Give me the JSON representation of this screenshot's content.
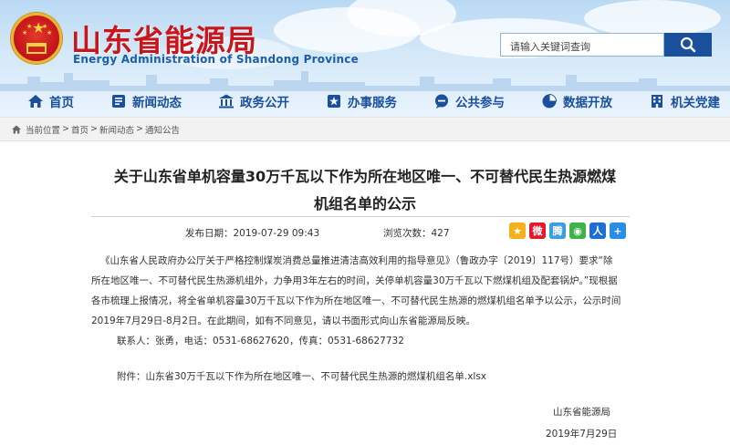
{
  "header": {
    "site_title": "山东省能源局",
    "site_subtitle": "Energy Administration of Shandong Province",
    "search_placeholder": "请输入关键词查询"
  },
  "nav": {
    "items": [
      {
        "label": "首页",
        "icon": "home-icon"
      },
      {
        "label": "新闻动态",
        "icon": "news-icon"
      },
      {
        "label": "政务公开",
        "icon": "government-building-icon"
      },
      {
        "label": "办事服务",
        "icon": "service-icon"
      },
      {
        "label": "公共参与",
        "icon": "chat-bubble-icon"
      },
      {
        "label": "数据开放",
        "icon": "pie-chart-icon"
      },
      {
        "label": "机关党建",
        "icon": "building-icon"
      }
    ]
  },
  "breadcrumb": {
    "prefix": "当前位置",
    "items": [
      "首页",
      "新闻动态",
      "通知公告"
    ],
    "separator": ">"
  },
  "article": {
    "title_line1": "关于山东省单机容量30万千瓦以下作为所在地区唯一、不可替代民生热源燃煤",
    "title_line2": "机组名单的公示",
    "publish_label": "发布日期：",
    "publish_date": "2019-07-29 09:43",
    "views_label": "浏览次数：",
    "views": "427",
    "para1_line1": "《山东省人民政府办公厅关于严格控制煤炭消费总量推进清洁高效利用的指导意见》（鲁政办字〔2019〕117号）要求“除",
    "para1_line2": "所在地区唯一、不可替代民生热源机组外，力争用3年左右的时间，关停单机容量30万千瓦以下燃煤机组及配套锅炉。”现根据",
    "para1_line3": "各市梳理上报情况，将全省单机容量30万千瓦以下作为所在地区唯一、不可替代民生热源的燃煤机组名单予以公示，公示时间",
    "para1_line4": "2019年7月29日-8月2日。在此期间，如有不同意见，请以书面形式向山东省能源局反映。",
    "contact": "联系人：张勇，电话：0531-68627620，传真：0531-68627732",
    "attachment": "附件：山东省30万千瓦以下作为所在地区唯一、不可替代民生热源的燃煤机组名单.xlsx",
    "signature_org": "山东省能源局",
    "signature_date": "2019年7月29日"
  },
  "share": [
    "qzone-icon",
    "weibo-icon",
    "tencent-weibo-icon",
    "wechat-icon",
    "renren-icon",
    "more-share-icon"
  ],
  "colors": {
    "brand_red": "#c8161d",
    "nav_blue": "#1a4f9c",
    "search_button": "#1a4f9c"
  }
}
